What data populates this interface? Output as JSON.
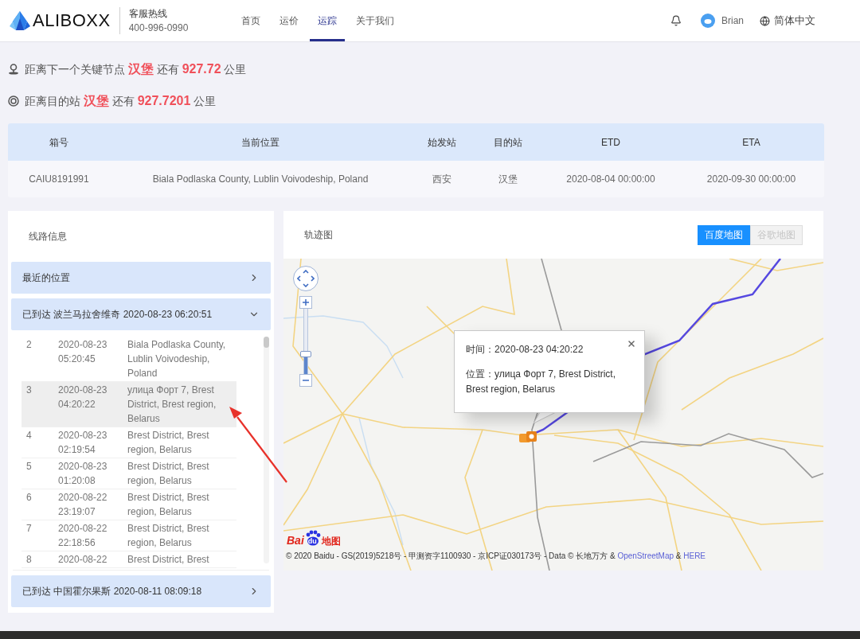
{
  "header": {
    "logo": "ALIBOXX",
    "hotline_label": "客服热线",
    "hotline_number": "400-996-0990",
    "nav": [
      {
        "label": "首页",
        "selected": false
      },
      {
        "label": "运价",
        "selected": false
      },
      {
        "label": "运踪",
        "selected": true
      },
      {
        "label": "关于我们",
        "selected": false
      }
    ],
    "user_name": "Brian",
    "language": "简体中文"
  },
  "distance_notes": [
    {
      "kind": "next_node",
      "text": "距离下一个关键节点 **汉堡** 还有 **927.72** 公里"
    },
    {
      "kind": "destination",
      "text": "距离目的站 **汉堡** 还有 **927.7201** 公里"
    }
  ],
  "shipment_table": {
    "columns": [
      "箱号",
      "当前位置",
      "始发站",
      "目的站",
      "ETD",
      "ETA"
    ],
    "rows": [
      [
        "CAIU8191991",
        "Biala Podlaska County, Lublin Voivodeship, Poland",
        "西安",
        "汉堡",
        "2020-08-04 00:00:00",
        "2020-09-30 00:00:00"
      ]
    ]
  },
  "route_panel": {
    "title": "线路信息",
    "sections": [
      {
        "title": "最近的位置",
        "expanded": false
      },
      {
        "title": "已到达 波兰马拉舍维奇 2020-08-23 06:20:51",
        "expanded": true,
        "events": [
          {
            "index": "2",
            "datetime": "2020-08-23 05:20:45",
            "location": "Biala Podlaska County, Lublin Voivodeship, Poland",
            "selected": false
          },
          {
            "index": "3",
            "datetime": "2020-08-23 04:20:22",
            "location": "улица Форт 7, Brest District, Brest region, Belarus",
            "selected": true
          },
          {
            "index": "4",
            "datetime": "2020-08-23 02:19:54",
            "location": "Brest District, Brest region, Belarus",
            "selected": false
          },
          {
            "index": "5",
            "datetime": "2020-08-23 01:20:08",
            "location": "Brest District, Brest region, Belarus",
            "selected": false
          },
          {
            "index": "6",
            "datetime": "2020-08-22 23:19:07",
            "location": "Brest District, Brest region, Belarus",
            "selected": false
          },
          {
            "index": "7",
            "datetime": "2020-08-22 22:18:56",
            "location": "Brest District, Brest region, Belarus",
            "selected": false
          },
          {
            "index": "8",
            "datetime": "2020-08-22",
            "location": "Brest District, Brest",
            "selected": false
          }
        ]
      },
      {
        "title": "已到达 中国霍尔果斯 2020-08-11 08:09:18",
        "expanded": false
      }
    ]
  },
  "map_panel": {
    "title": "轨迹图",
    "map_types": [
      {
        "label": "百度地图",
        "selected": true
      },
      {
        "label": "谷歌地图",
        "selected": false
      }
    ],
    "map": {
      "zoom_slider": {
        "level": 0.3
      },
      "popup": {
        "time": "时间：2020-08-23 04:20:22",
        "location": "位置：улица Форт 7, Brest District, Brest region, Belarus"
      },
      "logo": {
        "left": "Bai",
        "paw": "du",
        "right": "地图"
      },
      "attribution": [
        {
          "kind": "text",
          "text": "© 2020 Baidu - GS(2019)5218号 - 甲测资字1100930 - 京ICP证030173号 - Data © 长地万方 &"
        },
        {
          "kind": "link",
          "text": "OpenStreetMap"
        },
        {
          "kind": "text",
          "text": "&"
        },
        {
          "kind": "link",
          "text": "HERE"
        }
      ]
    }
  }
}
